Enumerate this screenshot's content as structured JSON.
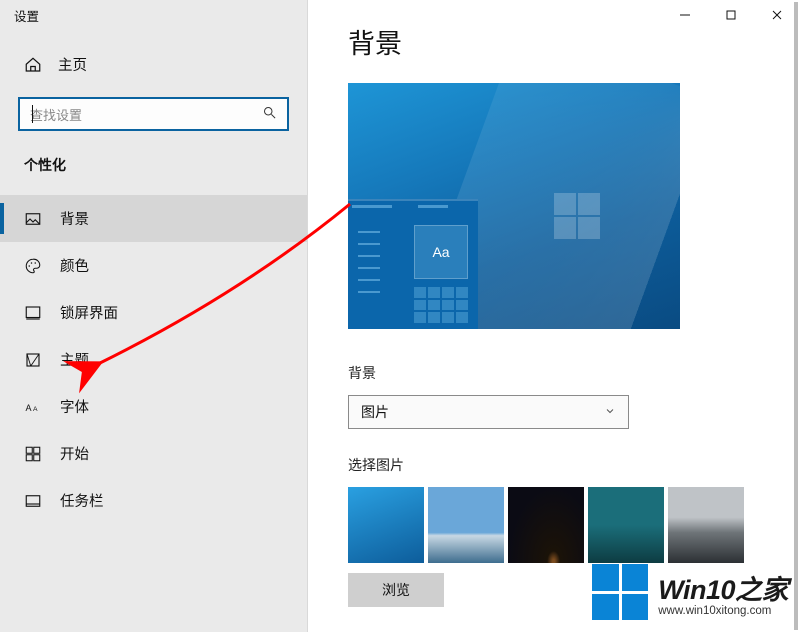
{
  "titlebar": {
    "title": "设置"
  },
  "sidebar": {
    "home_label": "主页",
    "search_placeholder": "查找设置",
    "section_label": "个性化",
    "items": [
      {
        "label": "背景",
        "icon": "picture-icon",
        "active": true
      },
      {
        "label": "颜色",
        "icon": "palette-icon",
        "active": false
      },
      {
        "label": "锁屏界面",
        "icon": "lock-screen-icon",
        "active": false
      },
      {
        "label": "主题",
        "icon": "theme-icon",
        "active": false
      },
      {
        "label": "字体",
        "icon": "font-icon",
        "active": false
      },
      {
        "label": "开始",
        "icon": "start-icon",
        "active": false
      },
      {
        "label": "任务栏",
        "icon": "taskbar-icon",
        "active": false
      }
    ]
  },
  "main": {
    "page_title": "背景",
    "preview_sample_text": "Aa",
    "bg_section_label": "背景",
    "bg_dropdown_value": "图片",
    "choose_picture_label": "选择图片",
    "browse_button": "浏览"
  },
  "watermark": {
    "title": "Win10之家",
    "url": "www.win10xitong.com"
  },
  "colors": {
    "accent": "#0a63a0",
    "watermark_logo": "#0a84d6"
  }
}
